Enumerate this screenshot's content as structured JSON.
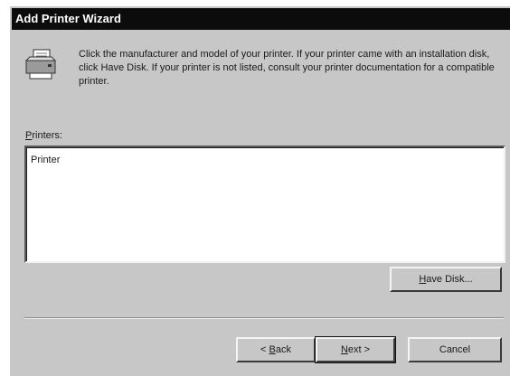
{
  "window": {
    "title": "Add Printer Wizard"
  },
  "header": {
    "icon": "printer-icon",
    "instructions": "Click the manufacturer and model of your printer. If your printer came with an installation disk, click Have Disk. If your printer is not listed, consult your printer documentation for a compatible printer."
  },
  "printers": {
    "label_mnemonic": "P",
    "label_rest": "rinters:",
    "items": [
      "Printer"
    ]
  },
  "buttons": {
    "have_disk_mnemonic": "H",
    "have_disk_rest": "ave Disk...",
    "back_prefix": "< ",
    "back_mnemonic": "B",
    "back_rest": "ack",
    "next_mnemonic": "N",
    "next_rest": "ext >",
    "cancel": "Cancel"
  },
  "colors": {
    "dialog_background": "#c7c7c7",
    "titlebar": "#0c0c0c",
    "list_background": "#ffffff"
  }
}
